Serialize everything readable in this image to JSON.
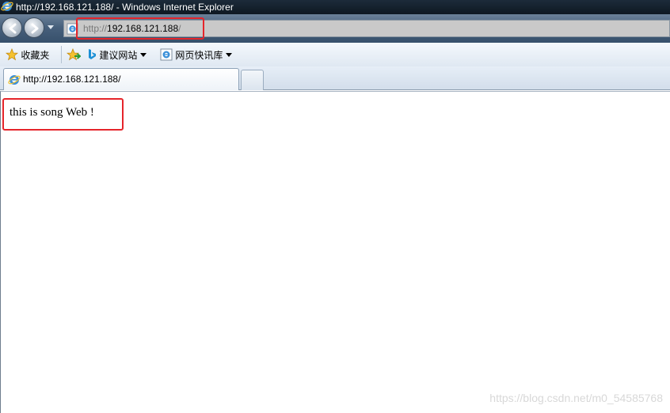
{
  "window": {
    "title": "http://192.168.121.188/ - Windows Internet Explorer"
  },
  "address_bar": {
    "scheme": "http://",
    "host": "192.168.121.188",
    "path": "/"
  },
  "favorites_bar": {
    "favorites_label": "收藏夹",
    "suggested_sites_label": "建议网站",
    "web_slice_label": "网页快讯库"
  },
  "tabs": [
    {
      "label": "http://192.168.121.188/",
      "active": true
    }
  ],
  "page": {
    "body_text": "this is song Web !"
  },
  "watermark": "https://blog.csdn.net/m0_54585768",
  "colors": {
    "highlight": "#e5252b",
    "titlebar": "#0e1822",
    "navbar": "#47607c",
    "address_bg": "#c9c9c9"
  },
  "icons": {
    "browser": "ie-icon",
    "back": "back-arrow-icon",
    "forward": "forward-arrow-icon",
    "favorites": "star-icon",
    "add_favorites": "add-favorites-icon",
    "bing": "bing-icon"
  }
}
